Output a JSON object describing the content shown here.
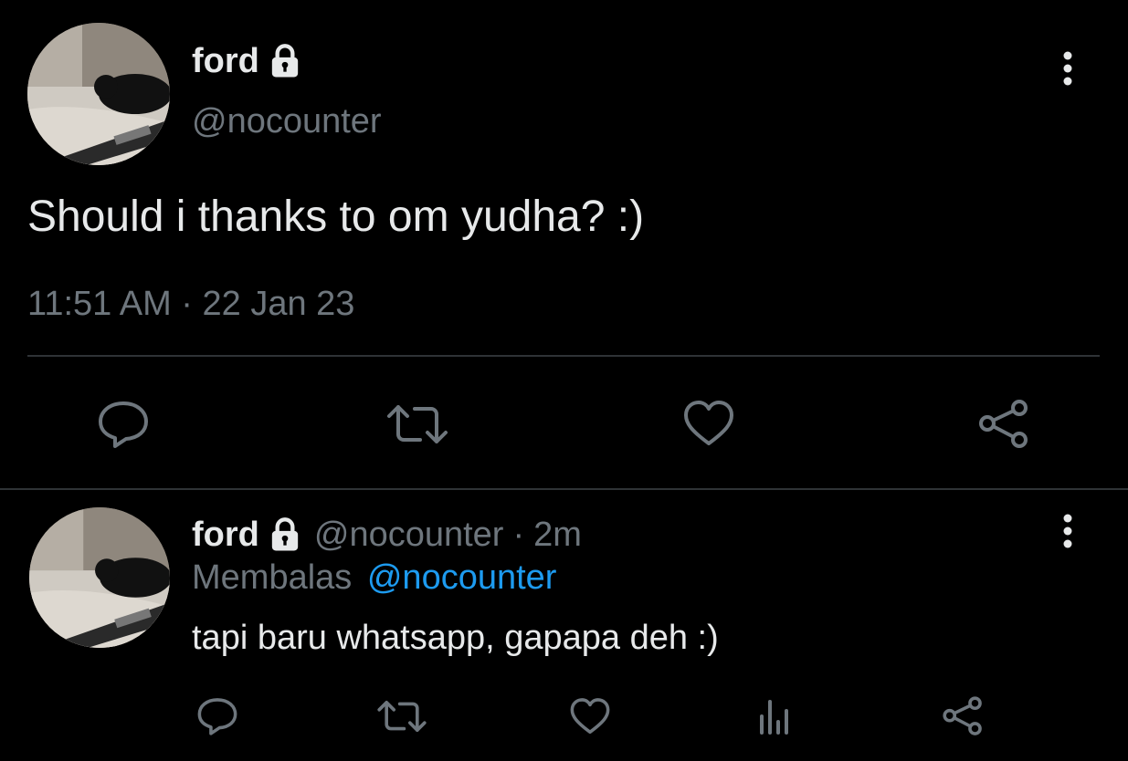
{
  "colors": {
    "background": "#000000",
    "text": "#e7e9ea",
    "muted": "#6e767d",
    "link": "#1d9bf0",
    "divider": "#2f3336"
  },
  "main_tweet": {
    "display_name": "ford",
    "handle": "@nocounter",
    "protected_icon": "lock-icon",
    "text": "Should i thanks to om yudha? :)",
    "timestamp": "11:51 AM · 22 Jan 23",
    "actions": [
      "reply-icon",
      "retweet-icon",
      "like-icon",
      "share-icon"
    ]
  },
  "reply_tweet": {
    "display_name": "ford",
    "handle": "@nocounter",
    "separator": "·",
    "time": "2m",
    "replying_label": "Membalas",
    "replying_to": "@nocounter",
    "text": "tapi baru whatsapp, gapapa deh :)",
    "actions": [
      "reply-icon",
      "retweet-icon",
      "like-icon",
      "analytics-icon",
      "share-icon"
    ]
  }
}
